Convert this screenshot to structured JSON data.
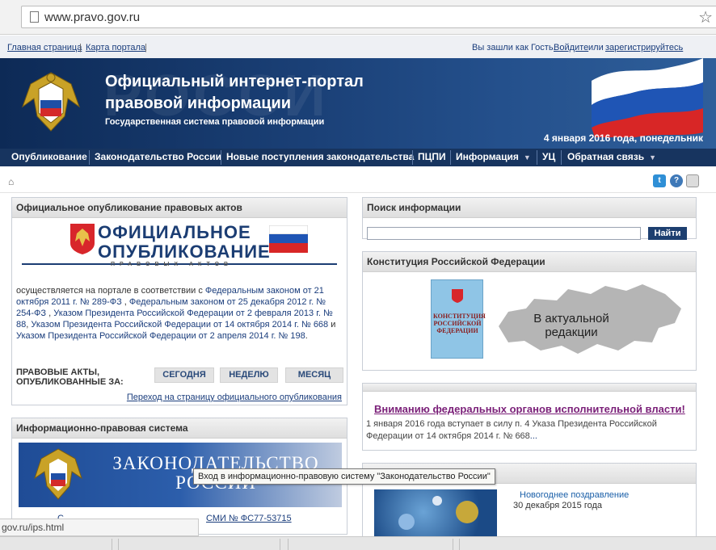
{
  "browser": {
    "url": "www.pravo.gov.ru"
  },
  "toplinks": {
    "home": "Главная страница",
    "map": "Карта портала",
    "guest_prefix": "Вы зашли как Гость.",
    "login": "Войдите",
    "or": "или",
    "register": "зарегистрируйтесь",
    "dot": "."
  },
  "header": {
    "watermark": "РОССИ",
    "title": "Официальный интернет-портал правовой информации",
    "subtitle": "Государственная система правовой информации",
    "date": "4 января 2016 года, понедельник"
  },
  "nav": {
    "items": [
      "Опубликование",
      "Законодательство России",
      "Новые поступления законодательства",
      "ПЦПИ",
      "Информация",
      "УЦ",
      "Обратная связь"
    ]
  },
  "publication": {
    "title": "Официальное опубликование правовых актов",
    "logo_line1": "ОФИЦИАЛЬНОЕ",
    "logo_line2": "ОПУБЛИКОВАНИЕ",
    "logo_line3": "ПРАВОВЫХ АКТОВ",
    "text_prefix": "осуществляется на портале в соответствии с ",
    "link1": "Федеральным законом от 21 октября 2011 г. № 289-ФЗ",
    "comma1": " , ",
    "link2": "Федеральным законом от 25 декабря 2012 г. № 254-ФЗ",
    "comma2": " , ",
    "link3": "Указом Президента Российской Федерации от 2 февраля 2013 г. № 88",
    "comma3": ", ",
    "link4": "Указом Президента Российской Федерации от 14 октября 2014 г. № 668",
    "and": " и ",
    "link5": "Указом Президента Российской Федерации от 2 апреля 2014 г. № 198",
    "text_end": ".",
    "acts_label_1": "ПРАВОВЫЕ АКТЫ,",
    "acts_label_2": "ОПУБЛИКОВАННЫЕ ЗА:",
    "btn_today": "СЕГОДНЯ",
    "btn_week": "НЕДЕЛЮ",
    "btn_month": "МЕСЯЦ",
    "goto_link": "Переход на страницу официального опубликования"
  },
  "ips": {
    "title": "Информационно-правовая система",
    "banner_line1": "ЗАКОНОДАТЕЛЬСТВО",
    "banner_line2": "РОССИИ",
    "smi_text": "С",
    "smi_link": "СМИ № ФС77-53715"
  },
  "search": {
    "title": "Поиск информации",
    "button": "Найти"
  },
  "constitution": {
    "title": "Конституция Российской Федерации",
    "book_text": "КОНСТИТУЦИЯ РОССИЙСКОЙ ФЕДЕРАЦИИ",
    "caption_line1": "В актуальной",
    "caption_line2": "редакции"
  },
  "notice": {
    "title": "Вниманию федеральных органов исполнительной власти!",
    "text": "1 января 2016 года вступает в силу п. 4 Указа Президента Российской Федерации от 14 октября 2014 г. № 668",
    "more": "..."
  },
  "news": {
    "item_link": "Новогоднее поздравление",
    "item_date": "30 декабря 2015 года"
  },
  "tooltip": "Вход в информационно-правовую систему \"Законодательство России\"",
  "statusbar": "gov.ru/ips.html"
}
